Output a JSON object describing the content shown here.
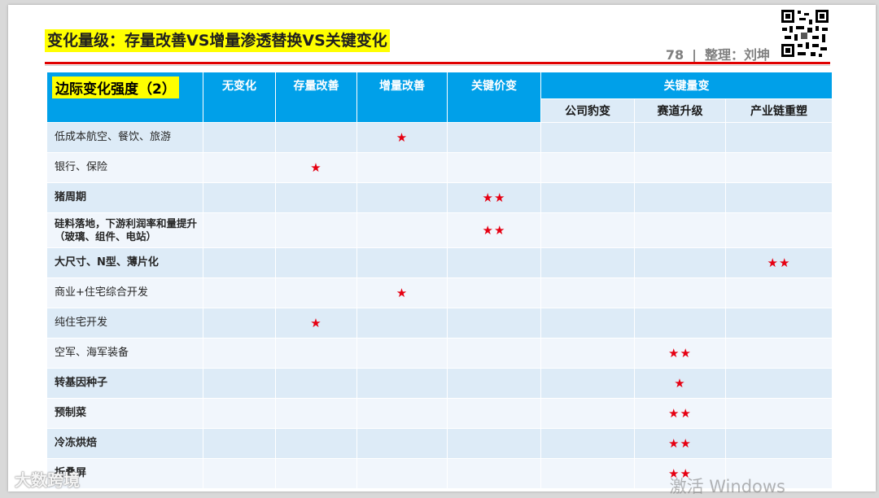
{
  "title": "变化量级：存量改善VS增量渗透替换VS关键变化",
  "page": {
    "number": "78",
    "separator": "|",
    "author": "整理：刘坤"
  },
  "table": {
    "corner_label": "边际变化强度（2）",
    "headers": [
      "无变化",
      "存量改善",
      "增量改善",
      "关键价变",
      "关键量变"
    ],
    "sub_headers": [
      "公司豹变",
      "赛道升级",
      "产业链重塑"
    ],
    "rows": [
      {
        "label": "低成本航空、餐饮、旅游",
        "cells": [
          "",
          "",
          "★",
          "",
          "",
          "",
          ""
        ]
      },
      {
        "label": "银行、保险",
        "cells": [
          "",
          "★",
          "",
          "",
          "",
          "",
          ""
        ]
      },
      {
        "label": "猪周期",
        "cells": [
          "",
          "",
          "",
          "★★",
          "",
          "",
          ""
        ]
      },
      {
        "label": "硅料落地，下游利润率和量提升（玻璃、组件、电站）",
        "cells": [
          "",
          "",
          "",
          "★★",
          "",
          "",
          ""
        ]
      },
      {
        "label": "大尺寸、N型、薄片化",
        "cells": [
          "",
          "",
          "",
          "",
          "",
          "",
          "★★"
        ]
      },
      {
        "label": "商业+住宅综合开发",
        "cells": [
          "",
          "",
          "★",
          "",
          "",
          "",
          ""
        ]
      },
      {
        "label": "纯住宅开发",
        "cells": [
          "",
          "★",
          "",
          "",
          "",
          "",
          ""
        ]
      },
      {
        "label": "空军、海军装备",
        "cells": [
          "",
          "",
          "",
          "",
          "",
          "★★",
          ""
        ]
      },
      {
        "label": "转基因种子",
        "cells": [
          "",
          "",
          "",
          "",
          "",
          "★",
          ""
        ]
      },
      {
        "label": "预制菜",
        "cells": [
          "",
          "",
          "",
          "",
          "",
          "★★",
          ""
        ]
      },
      {
        "label": "冷冻烘焙",
        "cells": [
          "",
          "",
          "",
          "",
          "",
          "★★",
          ""
        ]
      },
      {
        "label": "折叠屏",
        "cells": [
          "",
          "",
          "",
          "",
          "",
          "★★",
          ""
        ]
      }
    ]
  },
  "watermarks": {
    "left": "大数跨境",
    "right": "激活 Windows"
  },
  "colors": {
    "header_blue": "#00a0e9",
    "row_light": "#ddebf7",
    "star_red": "#e60012",
    "highlight": "#ffff00",
    "rule_red": "#e00000"
  }
}
